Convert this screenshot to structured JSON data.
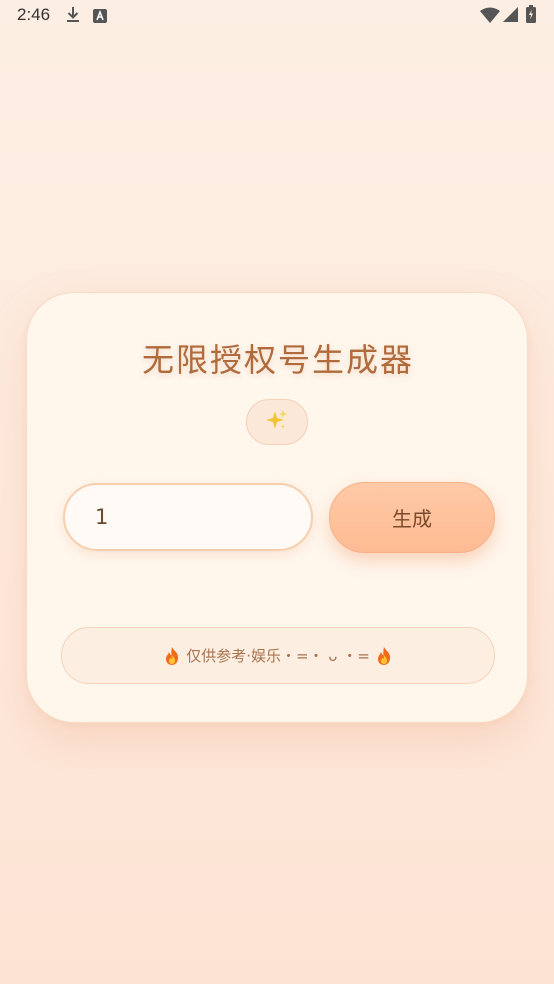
{
  "status_bar": {
    "time": "2:46",
    "left_icons": [
      "download-icon",
      "keyboard-a-icon"
    ],
    "right_icons": [
      "wifi-icon",
      "signal-icon",
      "battery-icon"
    ]
  },
  "card": {
    "title": "无限授权号生成器",
    "badge_icon": "sparkles-icon",
    "input": {
      "value": "1"
    },
    "generate_label": "生成",
    "disclaimer": {
      "text": "仅供参考·娱乐・=・ ᴗ ・=",
      "icon": "fire-icon"
    }
  },
  "colors": {
    "background": "#fdeee3",
    "card": "#fff6ec",
    "title": "#b06a3b",
    "button": "#fdbb93",
    "input_border": "#f7cfae"
  }
}
